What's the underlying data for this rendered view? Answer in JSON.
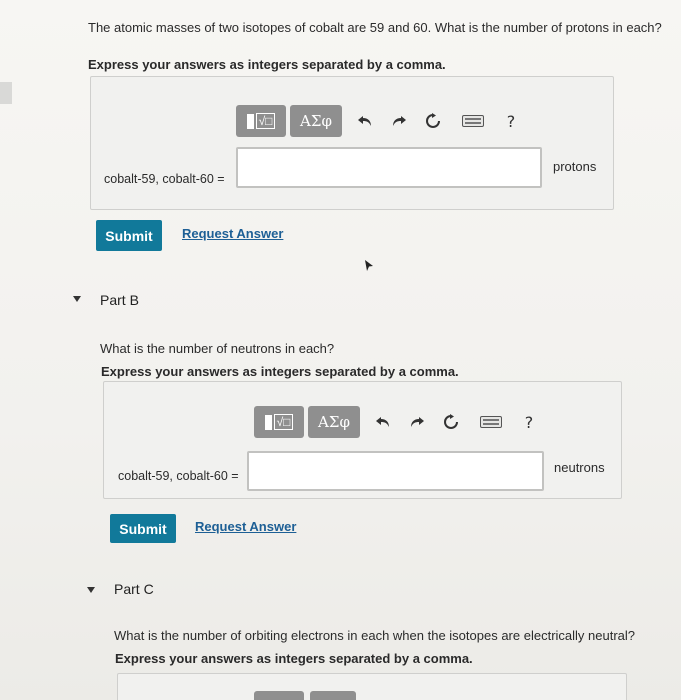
{
  "partA": {
    "question": "The atomic masses of two isotopes of cobalt are 59 and 60. What is the number of protons in each?",
    "instruction": "Express your answers as integers separated by a comma.",
    "answer_label": "cobalt-59, cobalt-60 =",
    "answer_value": "",
    "unit": "protons",
    "submit_label": "Submit",
    "request_label": "Request Answer"
  },
  "partB": {
    "title": "Part B",
    "question": "What is the number of neutrons in each?",
    "instruction": "Express your answers as integers separated by a comma.",
    "answer_label": "cobalt-59, cobalt-60 =",
    "answer_value": "",
    "unit": "neutrons",
    "submit_label": "Submit",
    "request_label": "Request Answer"
  },
  "partC": {
    "title": "Part C",
    "question": "What is the number of orbiting electrons in each when the isotopes are electrically neutral?",
    "instruction": "Express your answers as integers separated by a comma."
  },
  "toolbar": {
    "greek_label": "ΑΣφ",
    "help_label": "?",
    "icons": [
      "templates-icon",
      "greek-symbols-icon",
      "undo-icon",
      "redo-icon",
      "reset-icon",
      "keyboard-icon",
      "help-icon"
    ]
  },
  "colors": {
    "submit_bg": "#11799a",
    "link": "#1d5f95",
    "toolbar_bg": "#8f8f8f",
    "page_bg": "#f4f3f0"
  }
}
